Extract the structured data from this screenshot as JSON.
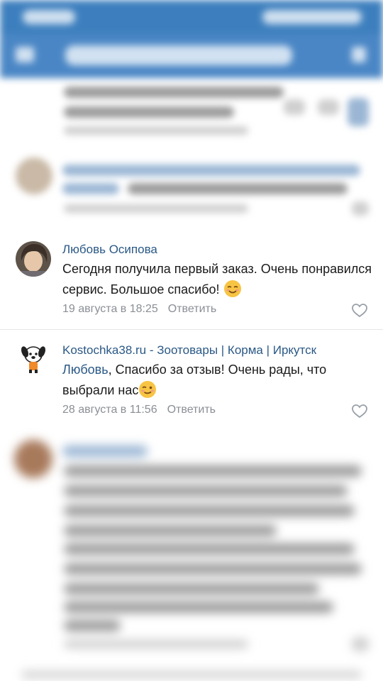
{
  "comments": [
    {
      "author": "Любовь Осипова",
      "text": "Сегодня получила первый заказ. Очень понравился сервис. Большое спасибо!",
      "emoji": "smiling-face-icon",
      "date": "19 августа в 18:25",
      "reply": "Ответить"
    },
    {
      "author": "Kostochka38.ru - Зоотовары | Корма | Иркутск",
      "mention": "Любовь",
      "text": ", Спасибо за отзыв! Очень рады, что выбрали нас",
      "emoji": "winking-face-icon",
      "date": "28 августа в 11:56",
      "reply": "Ответить"
    }
  ],
  "colors": {
    "appbar": "#4a86c5",
    "link": "#2a5885",
    "meta": "#8a8f96"
  }
}
